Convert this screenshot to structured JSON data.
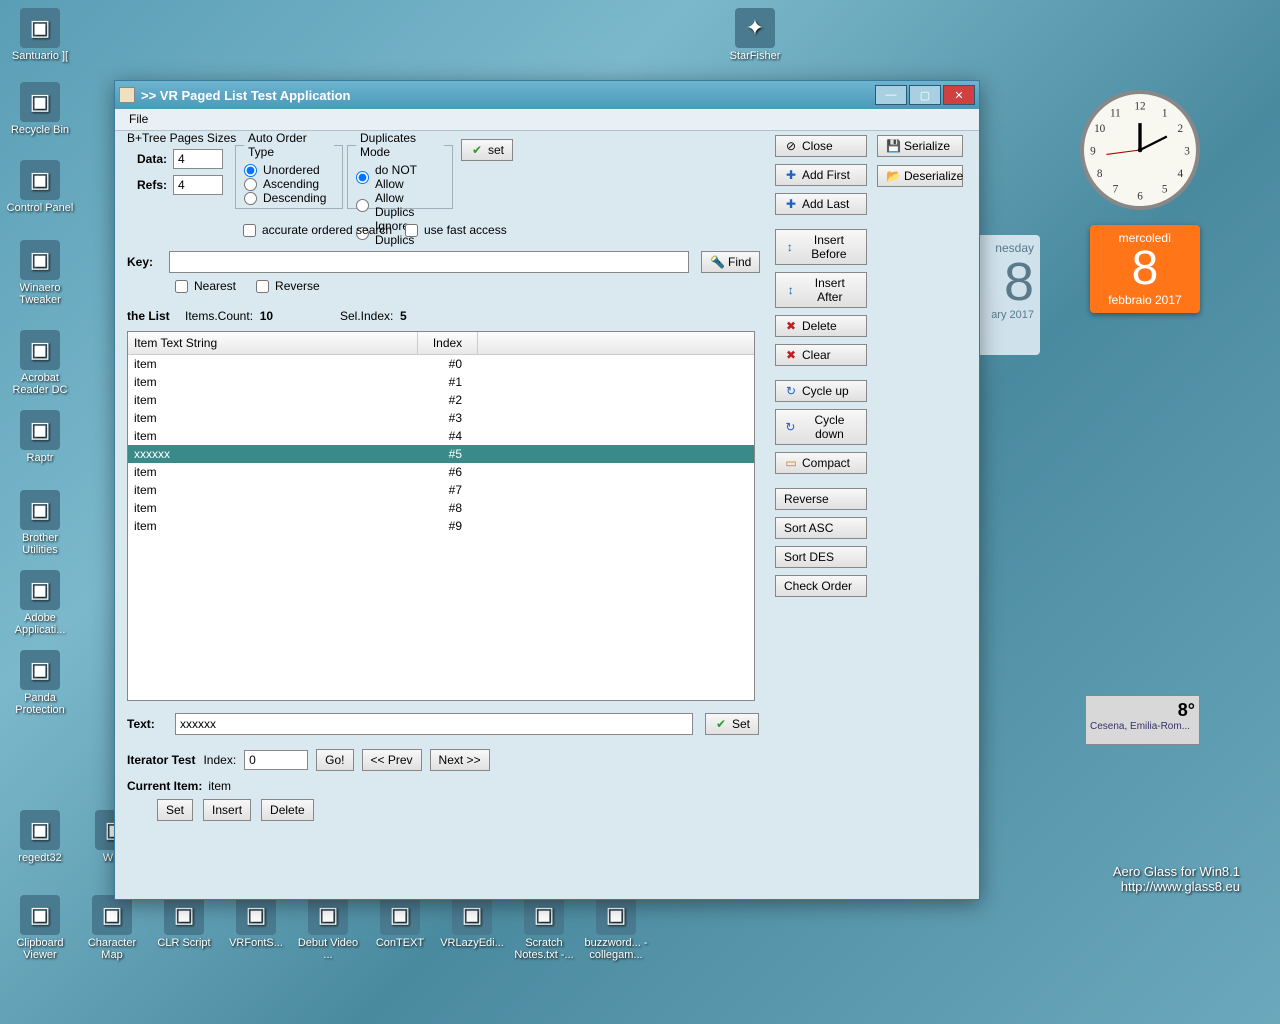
{
  "desktop_icons_left": [
    {
      "label": "Santuario ]["
    },
    {
      "label": "Recycle Bin"
    },
    {
      "label": "Control Panel"
    },
    {
      "label": "Winaero Tweaker"
    },
    {
      "label": "Acrobat Reader DC"
    },
    {
      "label": "Raptr"
    },
    {
      "label": "Brother Utilities"
    },
    {
      "label": "Adobe Applicati..."
    },
    {
      "label": "Panda Protection"
    },
    {
      "label": "regedt32"
    }
  ],
  "desktop_icons_bottom": [
    {
      "label": "Clipboard Viewer"
    },
    {
      "label": "Character Map"
    },
    {
      "label": "CLR Script"
    },
    {
      "label": "VRFontS..."
    },
    {
      "label": "Debut Video ..."
    },
    {
      "label": "ConTEXT"
    },
    {
      "label": "VRLazyEdi..."
    },
    {
      "label": "Scratch Notes.txt -..."
    },
    {
      "label": "buzzword... - collegam..."
    }
  ],
  "desktop_icon_top": {
    "label": "StarFisher"
  },
  "window": {
    "title": ">> VR Paged List Test Application",
    "menu_file": "File"
  },
  "btree": {
    "legend": "B+Tree Pages Sizes",
    "data_label": "Data:",
    "data_value": "4",
    "refs_label": "Refs:",
    "refs_value": "4"
  },
  "auto_order": {
    "legend": "Auto Order Type",
    "opt1": "Unordered",
    "opt2": "Ascending",
    "opt3": "Descending"
  },
  "dup_mode": {
    "legend": "Duplicates Mode",
    "opt1": "do NOT Allow",
    "opt2": "Allow Duplics",
    "opt3": "Ignore Duplics"
  },
  "set_btn": "set",
  "chk_accurate": "accurate ordered search",
  "chk_fast": "use fast access",
  "key_label": "Key:",
  "key_value": "",
  "find_btn": "Find",
  "chk_nearest": "Nearest",
  "chk_reverse": "Reverse",
  "list_label": "the List",
  "items_count_label": "Items.Count:",
  "items_count_value": "10",
  "sel_index_label": "Sel.Index:",
  "sel_index_value": "5",
  "columns": {
    "c1": "Item Text String",
    "c2": "Index"
  },
  "rows": [
    {
      "text": "item",
      "idx": "#0"
    },
    {
      "text": "item",
      "idx": "#1"
    },
    {
      "text": "item",
      "idx": "#2"
    },
    {
      "text": "item",
      "idx": "#3"
    },
    {
      "text": "item",
      "idx": "#4"
    },
    {
      "text": "xxxxxx",
      "idx": "#5",
      "selected": true
    },
    {
      "text": "item",
      "idx": "#6"
    },
    {
      "text": "item",
      "idx": "#7"
    },
    {
      "text": "item",
      "idx": "#8"
    },
    {
      "text": "item",
      "idx": "#9"
    }
  ],
  "side_buttons_a": [
    {
      "icon": "bi-close",
      "label": "Close"
    },
    {
      "icon": "bi-plus",
      "label": "Add First"
    },
    {
      "icon": "bi-plus",
      "label": "Add Last"
    },
    {
      "icon": "bi-ins",
      "label": "Insert Before"
    },
    {
      "icon": "bi-ins",
      "label": "Insert After"
    },
    {
      "icon": "bi-del",
      "label": "Delete"
    },
    {
      "icon": "bi-del",
      "label": "Clear"
    },
    {
      "icon": "bi-cycle",
      "label": "Cycle up"
    },
    {
      "icon": "bi-cycle",
      "label": "Cycle down"
    },
    {
      "icon": "bi-compact",
      "label": "Compact"
    },
    {
      "icon": "",
      "label": "Reverse"
    },
    {
      "icon": "",
      "label": "Sort ASC"
    },
    {
      "icon": "",
      "label": "Sort DES"
    },
    {
      "icon": "",
      "label": "Check Order"
    }
  ],
  "side_buttons_b": [
    {
      "icon": "bi-save",
      "label": "Serialize"
    },
    {
      "icon": "bi-open",
      "label": "Deserialize"
    }
  ],
  "text_label": "Text:",
  "text_value": "xxxxxx",
  "text_set_btn": "Set",
  "iterator_label": "Iterator Test",
  "index_label": "Index:",
  "index_value": "0",
  "go_btn": "Go!",
  "prev_btn": "<< Prev",
  "next_btn": "Next >>",
  "current_item_label": "Current Item:",
  "current_item_value": "item",
  "iter_set": "Set",
  "iter_insert": "Insert",
  "iter_delete": "Delete",
  "calendar": {
    "dayname": "mercoledì",
    "daynum": "8",
    "month": "febbraio 2017"
  },
  "weather": {
    "temp": "8°",
    "loc": "Cesena, Emilia-Rom..."
  },
  "bg_date": {
    "dayname": "nesday",
    "daynum": "8",
    "month": "ary 2017"
  },
  "watermark": {
    "l1": "Aero Glass for Win8.1",
    "l2": "http://www.glass8.eu"
  }
}
